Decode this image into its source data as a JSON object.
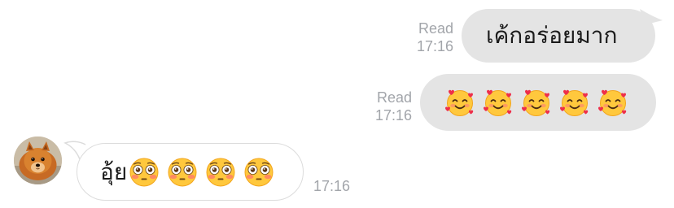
{
  "conversation": {
    "messages": [
      {
        "sender": "me",
        "text": "เค้กอร่อยมาก",
        "status": "Read",
        "time": "17:16"
      },
      {
        "sender": "me",
        "emojis": [
          "smiling-face-with-hearts",
          "smiling-face-with-hearts",
          "smiling-face-with-hearts",
          "smiling-face-with-hearts",
          "smiling-face-with-hearts"
        ],
        "status": "Read",
        "time": "17:16"
      },
      {
        "sender": "contact",
        "text": "อุ้ย",
        "emojis": [
          "flushed-face",
          "flushed-face",
          "flushed-face",
          "flushed-face"
        ],
        "time": "17:16"
      }
    ]
  },
  "colors": {
    "sent_bubble": "#e4e4e4",
    "received_bubble": "#ffffff",
    "received_border": "#dcdcdc",
    "meta_text": "#a2a5aa",
    "message_text": "#1b1b1b"
  }
}
